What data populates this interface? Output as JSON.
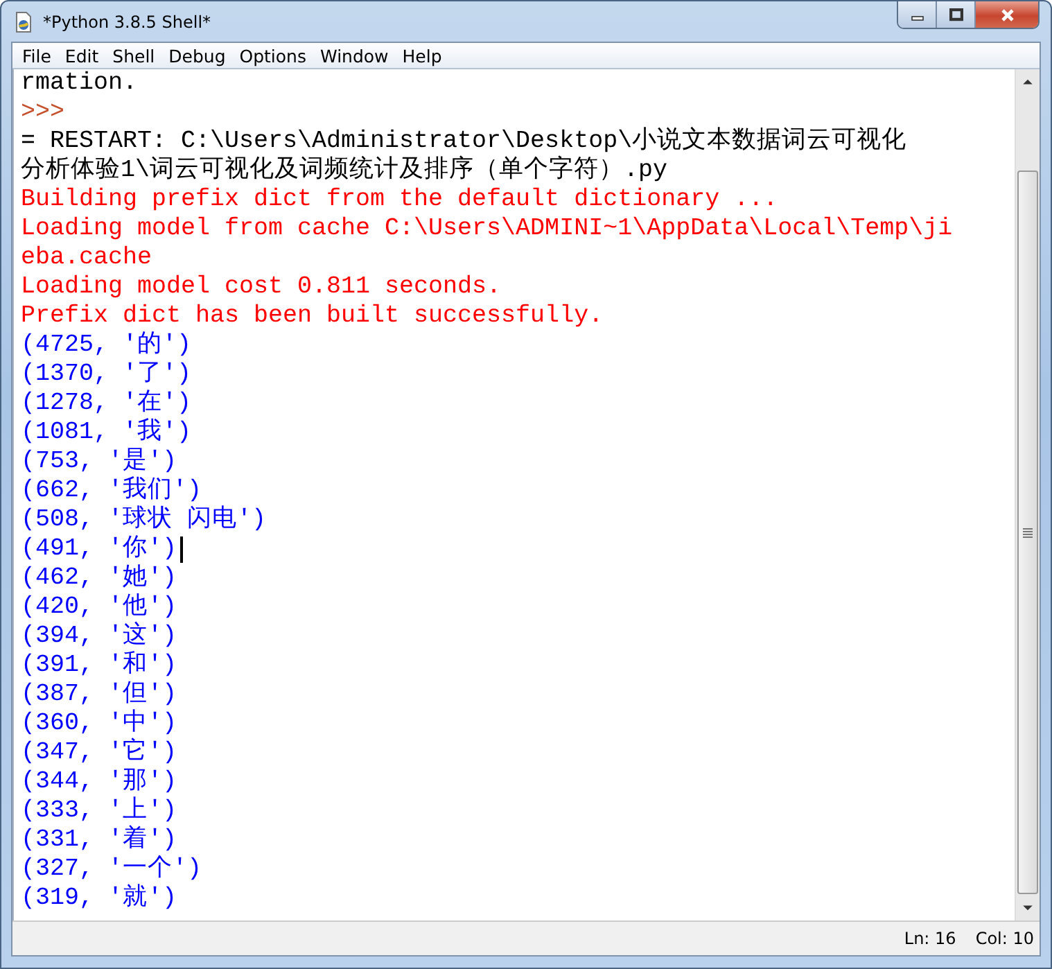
{
  "window": {
    "title": "*Python 3.8.5 Shell*"
  },
  "menu": [
    {
      "label": "File"
    },
    {
      "label": "Edit"
    },
    {
      "label": "Shell"
    },
    {
      "label": "Debug"
    },
    {
      "label": "Options"
    },
    {
      "label": "Window"
    },
    {
      "label": "Help"
    }
  ],
  "lines": [
    {
      "kind": "plain",
      "text": "rmation.",
      "cursor": false
    },
    {
      "kind": "prompt",
      "text": ">>>",
      "cursor": false
    },
    {
      "kind": "plain",
      "text": "= RESTART: C:\\Users\\Administrator\\Desktop\\小说文本数据词云可视化",
      "cursor": false
    },
    {
      "kind": "plain",
      "text": "分析体验1\\词云可视化及词频统计及排序（单个字符）.py",
      "cursor": false
    },
    {
      "kind": "stderr",
      "text": "Building prefix dict from the default dictionary ...",
      "cursor": false
    },
    {
      "kind": "stderr",
      "text": "Loading model from cache C:\\Users\\ADMINI~1\\AppData\\Local\\Temp\\ji",
      "cursor": false
    },
    {
      "kind": "stderr",
      "text": "eba.cache",
      "cursor": false
    },
    {
      "kind": "stderr",
      "text": "Loading model cost 0.811 seconds.",
      "cursor": false
    },
    {
      "kind": "stderr",
      "text": "Prefix dict has been built successfully.",
      "cursor": false
    },
    {
      "kind": "stdout",
      "text": "(4725, '的')",
      "cursor": false
    },
    {
      "kind": "stdout",
      "text": "(1370, '了')",
      "cursor": false
    },
    {
      "kind": "stdout",
      "text": "(1278, '在')",
      "cursor": false
    },
    {
      "kind": "stdout",
      "text": "(1081, '我')",
      "cursor": false
    },
    {
      "kind": "stdout",
      "text": "(753, '是')",
      "cursor": false
    },
    {
      "kind": "stdout",
      "text": "(662, '我们')",
      "cursor": false
    },
    {
      "kind": "stdout",
      "text": "(508, '球状 闪电')",
      "cursor": false
    },
    {
      "kind": "stdout",
      "text": "(491, '你')",
      "cursor": true
    },
    {
      "kind": "stdout",
      "text": "(462, '她')",
      "cursor": false
    },
    {
      "kind": "stdout",
      "text": "(420, '他')",
      "cursor": false
    },
    {
      "kind": "stdout",
      "text": "(394, '这')",
      "cursor": false
    },
    {
      "kind": "stdout",
      "text": "(391, '和')",
      "cursor": false
    },
    {
      "kind": "stdout",
      "text": "(387, '但')",
      "cursor": false
    },
    {
      "kind": "stdout",
      "text": "(360, '中')",
      "cursor": false
    },
    {
      "kind": "stdout",
      "text": "(347, '它')",
      "cursor": false
    },
    {
      "kind": "stdout",
      "text": "(344, '那')",
      "cursor": false
    },
    {
      "kind": "stdout",
      "text": "(333, '上')",
      "cursor": false
    },
    {
      "kind": "stdout",
      "text": "(331, '着')",
      "cursor": false
    },
    {
      "kind": "stdout",
      "text": "(327, '一个')",
      "cursor": false
    },
    {
      "kind": "stdout",
      "text": "(319, '就')",
      "cursor": false
    }
  ],
  "status_bar": {
    "line": "Ln: 16",
    "column": "Col: 10"
  }
}
